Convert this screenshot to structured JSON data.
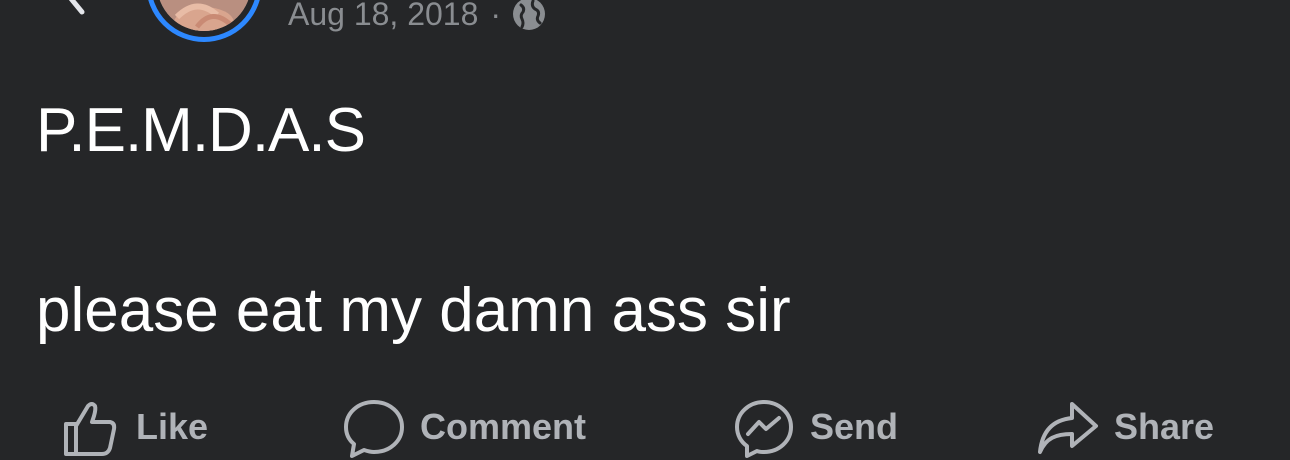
{
  "post": {
    "date": "Aug 18, 2018",
    "separator": "·",
    "audience_icon": "globe-icon",
    "text_line_1": "P.E.M.D.A.S",
    "text_line_2": "please eat my damn ass sir"
  },
  "actions": {
    "like_label": "Like",
    "comment_label": "Comment",
    "send_label": "Send",
    "share_label": "Share"
  },
  "colors": {
    "background": "#252628",
    "avatar_ring": "#2d88ff",
    "meta_text": "#8a8d91",
    "post_text": "#ffffff",
    "action_text": "#b0b3b8"
  }
}
